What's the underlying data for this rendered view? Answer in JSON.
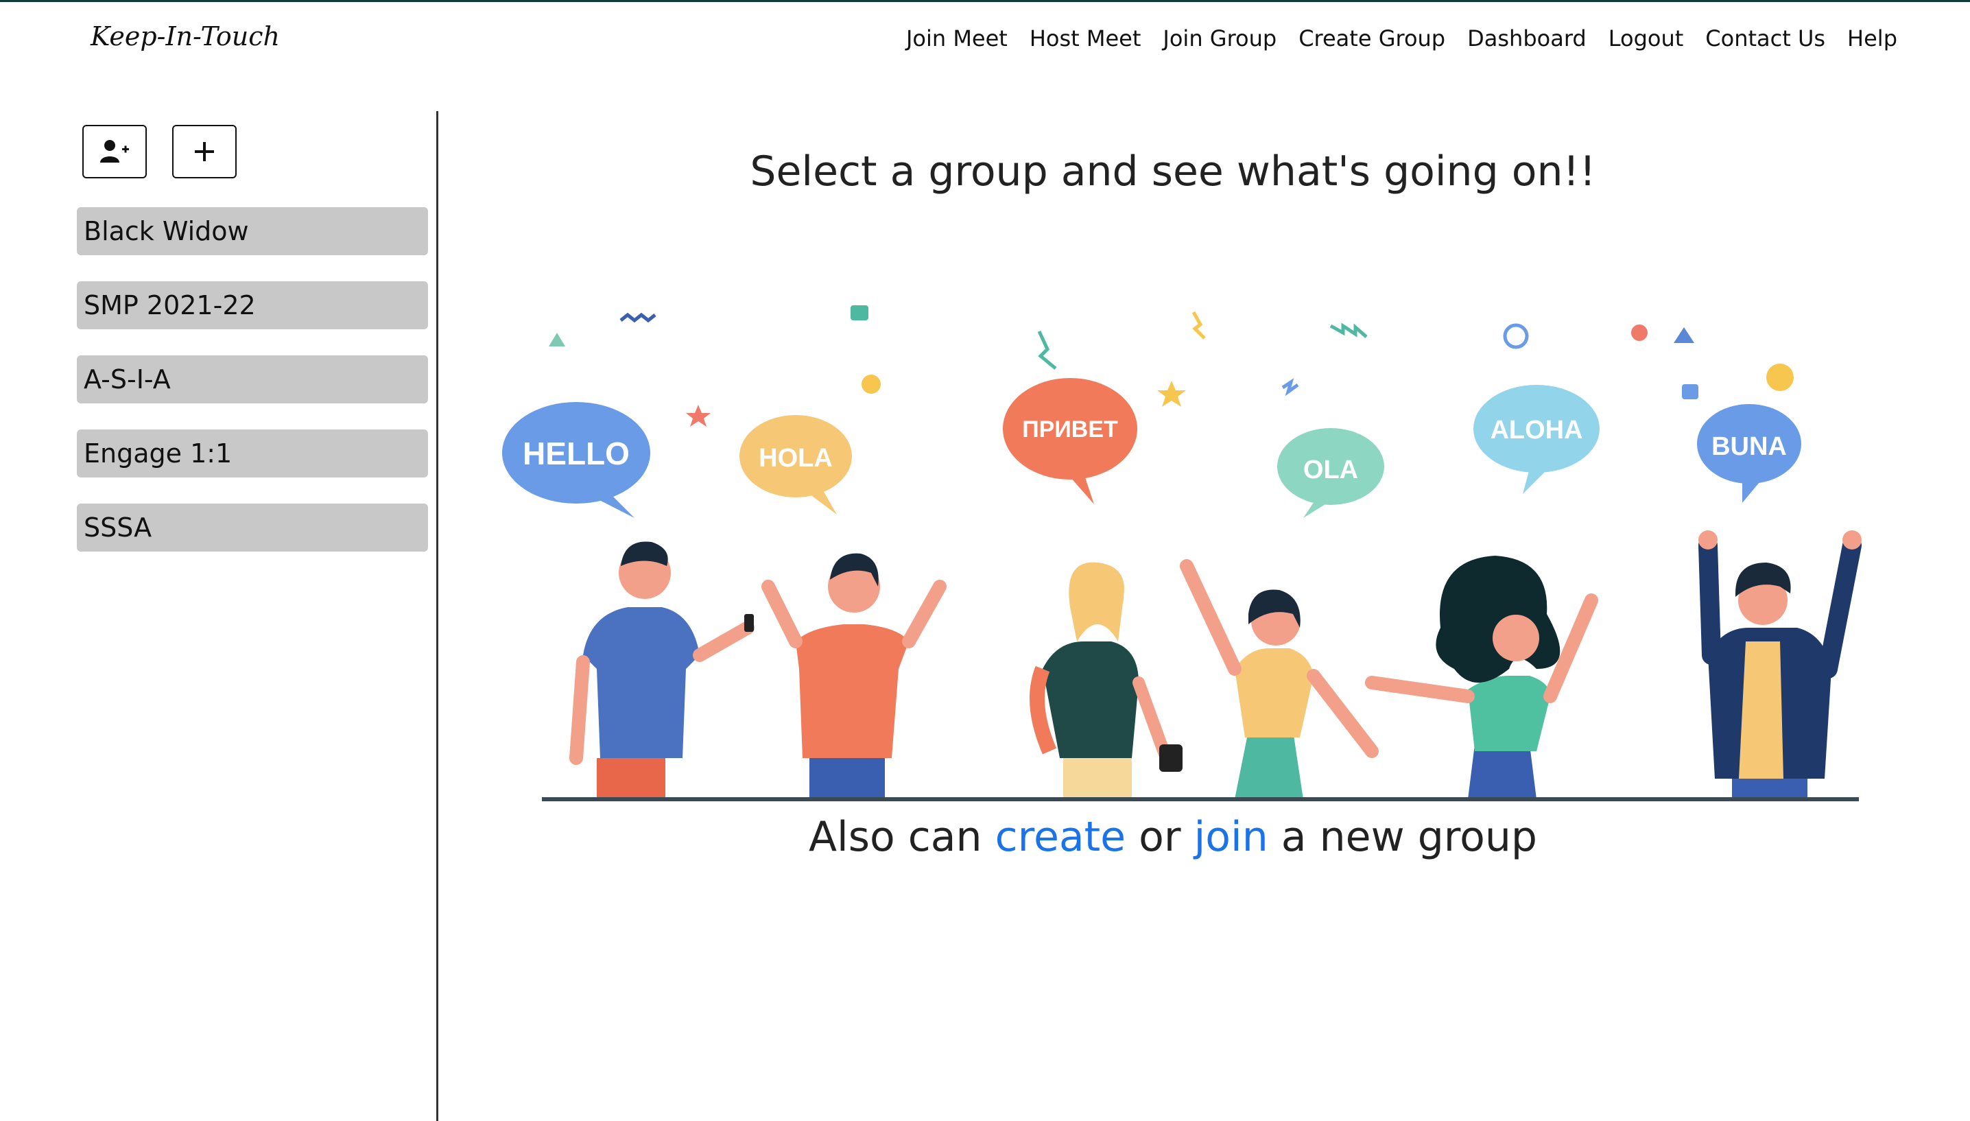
{
  "brand": "Keep-In-Touch",
  "nav": [
    "Join Meet",
    "Host Meet",
    "Join Group",
    "Create Group",
    "Dashboard",
    "Logout",
    "Contact Us",
    "Help"
  ],
  "sidebar": {
    "add_member_icon": "user-plus-icon",
    "add_group_icon": "plus-icon",
    "groups": [
      "Black Widow",
      "SMP 2021-22",
      "A-S-I-A",
      "Engage 1:1",
      "SSSA"
    ]
  },
  "main": {
    "headline": "Select a group and see what's going on!!",
    "sub": {
      "before": "Also can",
      "create": "create",
      "middle": "or",
      "join": "join",
      "after": "a new group"
    },
    "bubbles": [
      "HELLO",
      "HOLA",
      "ПРИВЕТ",
      "OLA",
      "ALOHA",
      "BUNA"
    ]
  },
  "colors": {
    "link": "#1a73e8",
    "group_bg": "#c8c8c8",
    "topline": "#0f3b3b"
  }
}
